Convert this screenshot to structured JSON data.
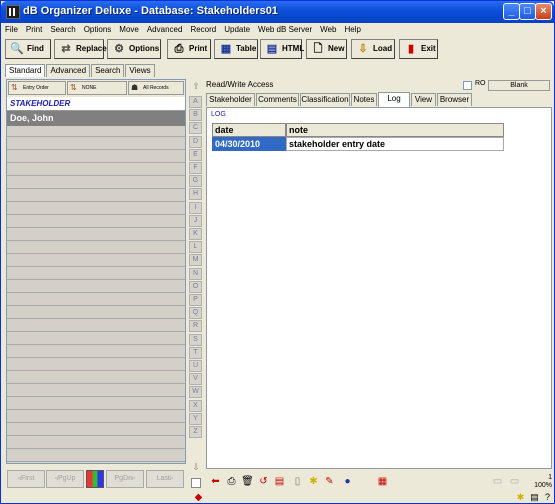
{
  "window": {
    "title": "dB Organizer Deluxe - Database: Stakeholders01"
  },
  "menu": [
    "File",
    "Print",
    "Search",
    "Options",
    "Move",
    "Advanced",
    "Record",
    "Update",
    "Web dB Server",
    "Web",
    "Help"
  ],
  "toolbar": {
    "find": "Find",
    "replace": "Replace",
    "options": "Options",
    "print": "Print",
    "table": "Table",
    "html": "HTML",
    "new": "New",
    "load": "Load",
    "exit": "Exit"
  },
  "view_tabs": [
    "Standard",
    "Advanced",
    "Search",
    "Views"
  ],
  "sort": {
    "entry_order": "Entry Order",
    "none": "NONE",
    "all_records": "All Records"
  },
  "list": {
    "header": "STAKEHOLDER",
    "items": [
      "Doe, John"
    ]
  },
  "alphabet": [
    "A",
    "B",
    "C",
    "D",
    "E",
    "F",
    "G",
    "H",
    "I",
    "J",
    "K",
    "L",
    "M",
    "N",
    "O",
    "P",
    "Q",
    "R",
    "S",
    "T",
    "U",
    "V",
    "W",
    "X",
    "Y",
    "Z"
  ],
  "record": {
    "access": "Read/Write Access",
    "ro_label": "RO",
    "blank_button": "Blank",
    "tabs": [
      "Stakeholder",
      "Comments",
      "Classification",
      "Notes",
      "Log",
      "View",
      "Browser"
    ],
    "active_tab": "Log",
    "section_label": "LOG",
    "log": {
      "columns": [
        "date",
        "note"
      ],
      "rows": [
        {
          "date": "04/30/2010",
          "note": "stakeholder entry date"
        }
      ]
    }
  },
  "nav": {
    "first": "First",
    "pgup": "PgUp",
    "pgdn": "PgDn",
    "last": "Last"
  },
  "status": {
    "count": "1",
    "zoom": "100%"
  }
}
